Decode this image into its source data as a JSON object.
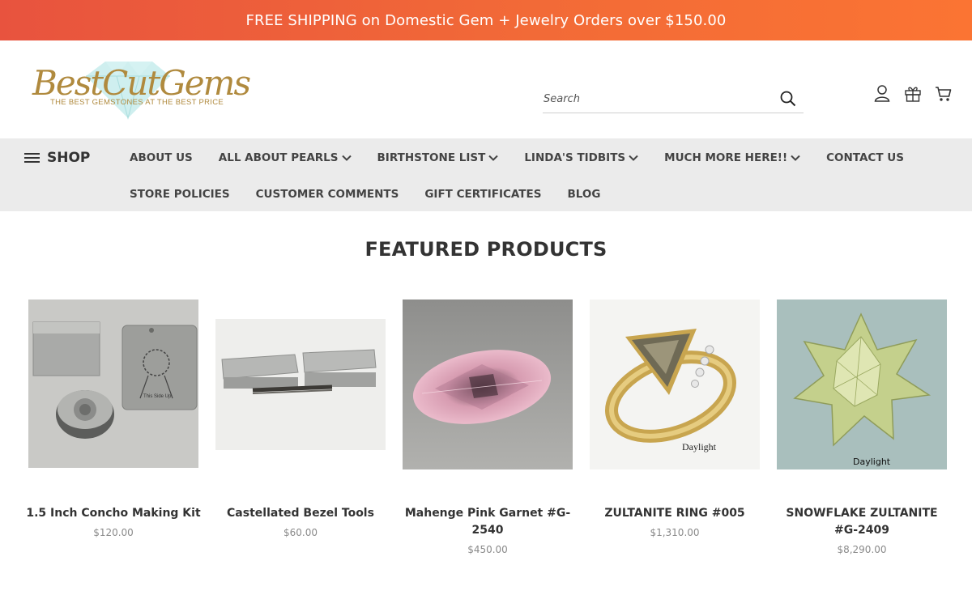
{
  "banner": {
    "text": "FREE SHIPPING on Domestic Gem + Jewelry Orders over $150.00"
  },
  "logo": {
    "name": "BestCutGems",
    "tagline": "THE BEST GEMSTONES AT THE BEST PRICE"
  },
  "search": {
    "placeholder": "Search"
  },
  "header_icons": [
    "account-icon",
    "gift-icon",
    "cart-icon"
  ],
  "nav": {
    "shop_label": "SHOP",
    "row1": [
      {
        "label": "ABOUT US",
        "dropdown": false
      },
      {
        "label": "ALL ABOUT PEARLS",
        "dropdown": true
      },
      {
        "label": "BIRTHSTONE LIST",
        "dropdown": true
      },
      {
        "label": "LINDA'S TIDBITS",
        "dropdown": true
      },
      {
        "label": "MUCH MORE HERE!!",
        "dropdown": true
      },
      {
        "label": "CONTACT US",
        "dropdown": false
      }
    ],
    "row2": [
      {
        "label": "STORE POLICIES",
        "dropdown": false
      },
      {
        "label": "CUSTOMER COMMENTS",
        "dropdown": false
      },
      {
        "label": "GIFT CERTIFICATES",
        "dropdown": false
      },
      {
        "label": "BLOG",
        "dropdown": false
      }
    ]
  },
  "featured": {
    "title": "FEATURED PRODUCTS",
    "products": [
      {
        "name": "1.5 Inch Concho Making Kit",
        "price": "$120.00",
        "image_labels": [
          "This Side Up"
        ]
      },
      {
        "name": "Castellated Bezel Tools",
        "price": "$60.00",
        "image_labels": []
      },
      {
        "name": "Mahenge Pink Garnet #G-2540",
        "price": "$450.00",
        "image_labels": []
      },
      {
        "name": "ZULTANITE RING #005",
        "price": "$1,310.00",
        "image_labels": [
          "Daylight"
        ]
      },
      {
        "name": "SNOWFLAKE ZULTANITE #G-2409",
        "price": "$8,290.00",
        "image_labels": [
          "Daylight"
        ]
      }
    ]
  },
  "colors": {
    "banner_start": "#e8533e",
    "banner_end": "#fb7433",
    "nav_bg": "#ebebeb",
    "logo_gold": "#b08a3e",
    "text_dark": "#333333",
    "price_gray": "#8a8a8a"
  }
}
